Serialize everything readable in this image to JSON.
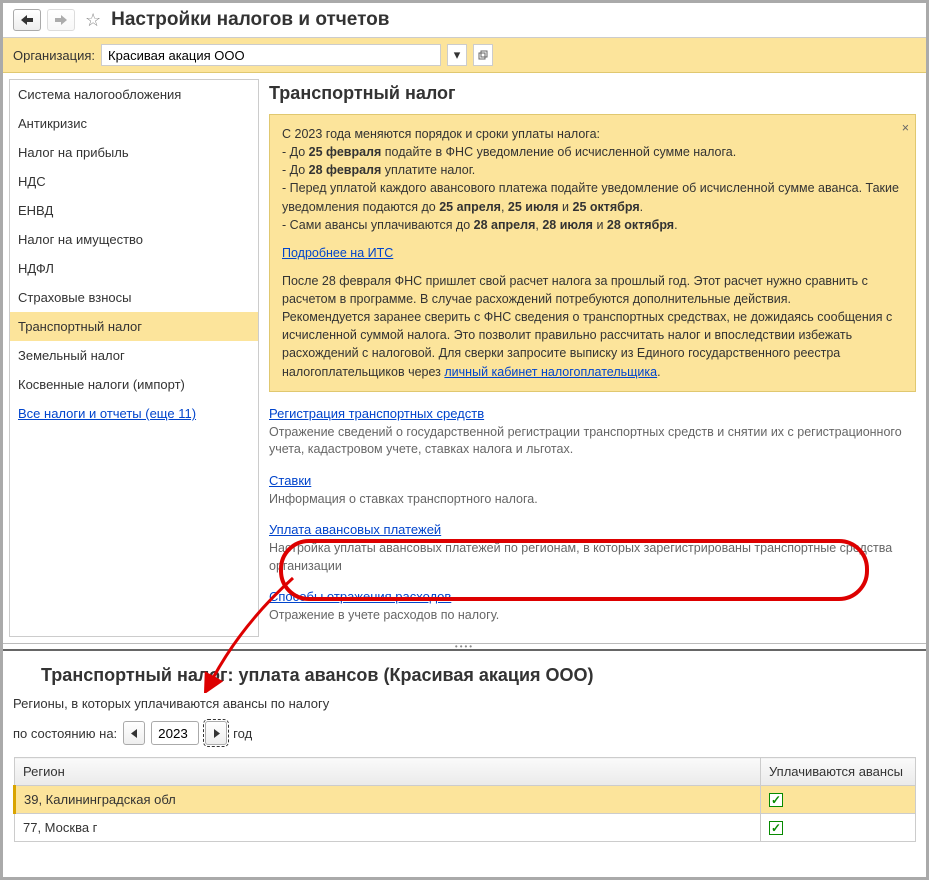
{
  "header": {
    "title": "Настройки налогов и отчетов"
  },
  "org": {
    "label": "Организация:",
    "value": "Красивая акация ООО"
  },
  "sidebar": {
    "items": [
      "Система налогообложения",
      "Антикризис",
      "Налог на прибыль",
      "НДС",
      "ЕНВД",
      "Налог на имущество",
      "НДФЛ",
      "Страховые взносы",
      "Транспортный налог",
      "Земельный налог",
      "Косвенные налоги (импорт)"
    ],
    "more": "Все налоги и отчеты (еще 11)",
    "selected_index": 8
  },
  "content": {
    "title": "Транспортный налог",
    "info": {
      "line1": "С 2023 года меняются порядок и сроки уплаты налога:",
      "li1_a": " - До ",
      "li1_b": "25 февраля",
      "li1_c": " подайте в ФНС уведомление об исчисленной сумме налога.",
      "li2_a": " - До ",
      "li2_b": "28 февраля",
      "li2_c": " уплатите налог.",
      "li3_a": " - Перед уплатой каждого авансового платежа подайте уведомление об исчисленной сумме аванса. Такие уведомления подаются до ",
      "li3_b": "25 апреля",
      "li3_c": ", ",
      "li3_d": "25 июля",
      "li3_e": " и ",
      "li3_f": "25 октября",
      "li3_g": ".",
      "li4_a": " - Сами авансы уплачиваются до ",
      "li4_b": "28 апреля",
      "li4_c": ", ",
      "li4_d": "28 июля",
      "li4_e": " и ",
      "li4_f": "28 октября",
      "li4_g": ".",
      "more_link": "Подробнее на ИТС",
      "para2_a": "После 28 февраля ФНС пришлет свой расчет налога за прошлый год. Этот расчет нужно сравнить с расчетом в программе. В случае расхождений потребуются дополнительные действия.",
      "para2_b": "Рекомендуется заранее сверить с ФНС сведения о транспортных средствах, не дожидаясь сообщения с исчисленной суммой налога. Это позволит правильно рассчитать налог и впоследствии избежать расхождений с налоговой. Для сверки запросите выписку из Единого государственного реестра налогоплательщиков через ",
      "cabinet_link": "личный кабинет налогоплательщика",
      "dot": "."
    },
    "sections": [
      {
        "link": "Регистрация транспортных средств",
        "desc": "Отражение сведений о государственной регистрации транспортных средств и снятии их с регистрационного учета, кадастровом учете, ставках налога и льготах."
      },
      {
        "link": "Ставки",
        "desc": "Информация о ставках транспортного налога."
      },
      {
        "link": "Уплата авансовых платежей",
        "desc": "Настройка уплаты авансовых платежей по регионам, в которых зарегистрированы транспортные средства организации"
      },
      {
        "link": "Способы отражения расходов",
        "desc": "Отражение в учете расходов по налогу."
      }
    ]
  },
  "bottom": {
    "title": "Транспортный налог: уплата авансов (Красивая акация ООО)",
    "sub": "Регионы, в которых уплачиваются авансы по налогу",
    "as_of": "по состоянию на:",
    "year": "2023",
    "year_suffix": "год",
    "columns": {
      "region": "Регион",
      "advance": "Уплачиваются авансы"
    },
    "rows": [
      {
        "region": "39, Калининградская обл",
        "advance": true,
        "selected": true
      },
      {
        "region": "77, Москва г",
        "advance": true,
        "selected": false
      }
    ]
  }
}
